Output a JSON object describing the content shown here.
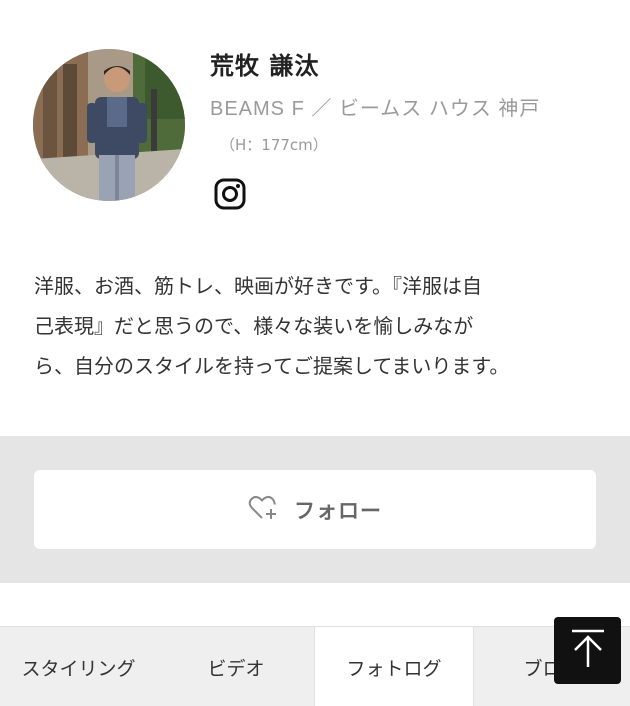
{
  "profile": {
    "name": "荒牧 謙汰",
    "shop": "BEAMS F ／ ビームス ハウス 神戸",
    "height": "（H：177cm）",
    "instagram_icon": "instagram-icon",
    "bio_lines": [
      "洋服、お酒、筋トレ、映画が好きです。『洋服は自",
      "己表現』だと思うので、様々な装いを愉しみなが",
      "ら、自分のスタイルを持ってご提案してまいります。"
    ]
  },
  "follow": {
    "label": "フォロー",
    "icon": "heart-plus-icon"
  },
  "tabs": [
    {
      "label": "スタイリング",
      "active": false
    },
    {
      "label": "ビデオ",
      "active": false
    },
    {
      "label": "フォトログ",
      "active": true
    },
    {
      "label": "ブログ",
      "active": false
    }
  ],
  "scroll_top": {
    "icon": "arrow-up-icon"
  },
  "colors": {
    "follow_band": "#e5e5e5",
    "tab_bar": "#efefef",
    "muted_text": "#9a9a9a",
    "scroll_top_bg": "#111111"
  }
}
